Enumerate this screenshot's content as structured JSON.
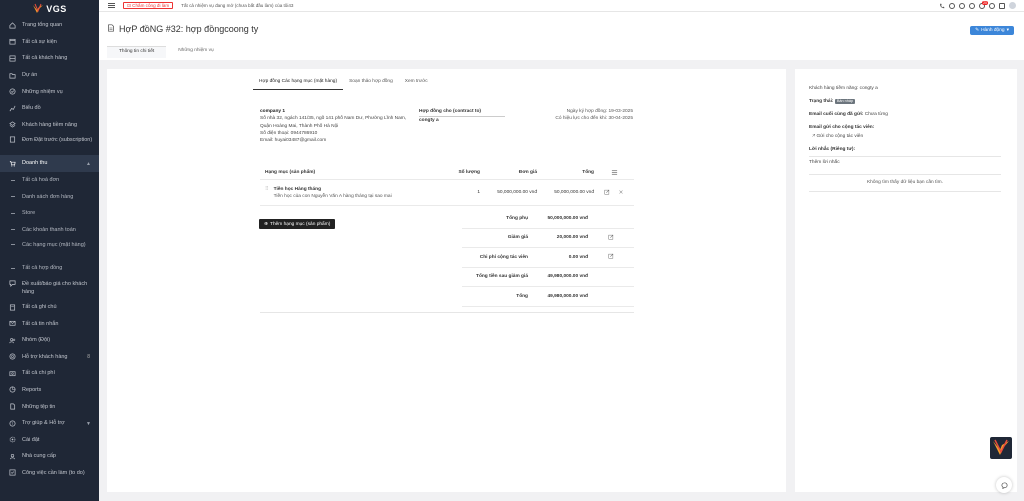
{
  "brand": {
    "name": "VGS"
  },
  "sidebar": {
    "items": [
      {
        "label": "Trang tổng quan",
        "icon": "home-icon"
      },
      {
        "label": "Tất cả sự kiện",
        "icon": "calendar-icon"
      },
      {
        "label": "Tất cả khách hàng",
        "icon": "users-icon"
      },
      {
        "label": "Dự án",
        "icon": "folder-icon"
      },
      {
        "label": "Những nhiệm vụ",
        "icon": "tasks-icon"
      },
      {
        "label": "Biểu đồ",
        "icon": "chart-icon"
      },
      {
        "label": "Khách hàng tiềm năng",
        "icon": "layers-icon"
      },
      {
        "label": "Đơn Đặt trước (subscription)",
        "icon": "document-icon"
      },
      {
        "label": "Doanh thu",
        "icon": "cart-icon"
      }
    ],
    "revenue_sub": [
      "Tất cả hoá đơn",
      "Danh sách đơn hàng",
      "Store",
      "Các khoản thanh toán",
      "Các hạng mục (mặt hàng)",
      "Tất cả hợp đồng"
    ],
    "items_after": [
      {
        "label": "Đề xuất/báo giá cho khách hàng",
        "icon": "proposal-icon"
      },
      {
        "label": "Tất cả ghi chú",
        "icon": "note-icon"
      },
      {
        "label": "Tất cả tin nhắn",
        "icon": "message-icon"
      },
      {
        "label": "Nhóm (Đội)",
        "icon": "team-icon"
      },
      {
        "label": "Hỗ trợ khách hàng",
        "icon": "support-icon"
      },
      {
        "label": "Tất cả chi phí",
        "icon": "expense-icon"
      },
      {
        "label": "Reports",
        "icon": "report-icon"
      },
      {
        "label": "Những tệp tin",
        "icon": "file-icon"
      },
      {
        "label": "Trợ giúp & Hỗ trợ",
        "icon": "help-icon"
      },
      {
        "label": "Cài đặt",
        "icon": "settings-icon"
      },
      {
        "label": "Nhà cung cấp",
        "icon": "vendor-icon"
      },
      {
        "label": "Công việc cần làm (to do)",
        "icon": "todo-icon"
      }
    ]
  },
  "topbar": {
    "clock_label": "Chấm công đi làm",
    "note": "Tất cả nhiệm vụ đang mở (chưa bắt đầu làm) của tôi43",
    "notif_count": "20"
  },
  "page": {
    "title": "HợP đồNG #32: hợp đồngcoong ty",
    "action_label": "Hành động",
    "tabs": [
      "Thông tin chi tiết",
      "Những nhiệm vụ"
    ]
  },
  "contract": {
    "inner_tabs": [
      "Hợp đồng Các hạng mục (mặt hàng)",
      "Soạn thảo hợp đồng",
      "Xem trước"
    ],
    "company": {
      "name": "company 1",
      "address1": "Số nhà 32, ngách 141/35, ngõ 141 phố Nam Dư, Phường Lĩnh Nam,",
      "address2": "Quận Hoàng Mai, Thành Phố Hà Nội",
      "phone": "Số điện thoại: 0944786910",
      "email": "Email: huyai03487@gmail.com"
    },
    "contract_for_label": "Hợp đồng cho (contract to)",
    "contract_for_value": "congty a",
    "signed_date": "Ngày ký hợp đồng: 19-03-2025",
    "valid_until": "Có hiệu lực cho đến khi: 30-04-2025",
    "table": {
      "headers": [
        "Hạng mục (sản phẩm)",
        "Số lượng",
        "Đơn giá",
        "Tổng"
      ],
      "rows": [
        {
          "title": "Tiền học Hàng tháng",
          "desc": "Tiền học của con Nguyễn Văn A hàng tháng tại sao mai",
          "qty": "1",
          "price": "50,000,000.00 vnđ",
          "total": "50,000,000.00 vnđ"
        }
      ]
    },
    "add_item_label": "Thêm hạng mục (sản phẩm)",
    "summary": [
      {
        "label": "Tổng phụ",
        "value": "50,000,000.00 vnđ",
        "editable": false
      },
      {
        "label": "Giảm giá",
        "value": "20,000.00 vnđ",
        "editable": true
      },
      {
        "label": "Chi phí cộng tác viên",
        "value": "0.00 vnđ",
        "editable": true
      },
      {
        "label": "Tổng tiền sau giảm giá",
        "value": "49,980,000.00 vnđ",
        "editable": false
      },
      {
        "label": "Tổng",
        "value": "49,980,000.00 vnđ",
        "editable": false
      }
    ]
  },
  "right_panel": {
    "lead": "Khách hàng tiềm năng: congty a",
    "status_label": "Trạng thái:",
    "status_value": "Bản nháp",
    "last_email_label": "Email cuối cùng đã gửi:",
    "last_email_value": "Chưa từng",
    "send_email_label": "Email gửi cho cộng tác viên:",
    "send_email_link": "Gửi cho cộng tác viên",
    "reminder_label": "Lời nhắc (Riêng tư):",
    "add_reminder": "Thêm lời nhắc",
    "no_data": "Không tìm thấy dữ liệu bạn cần tìm."
  },
  "colors": {
    "sidebar_bg": "#1f2736",
    "accent": "#3c86d9",
    "danger": "#e33333"
  }
}
